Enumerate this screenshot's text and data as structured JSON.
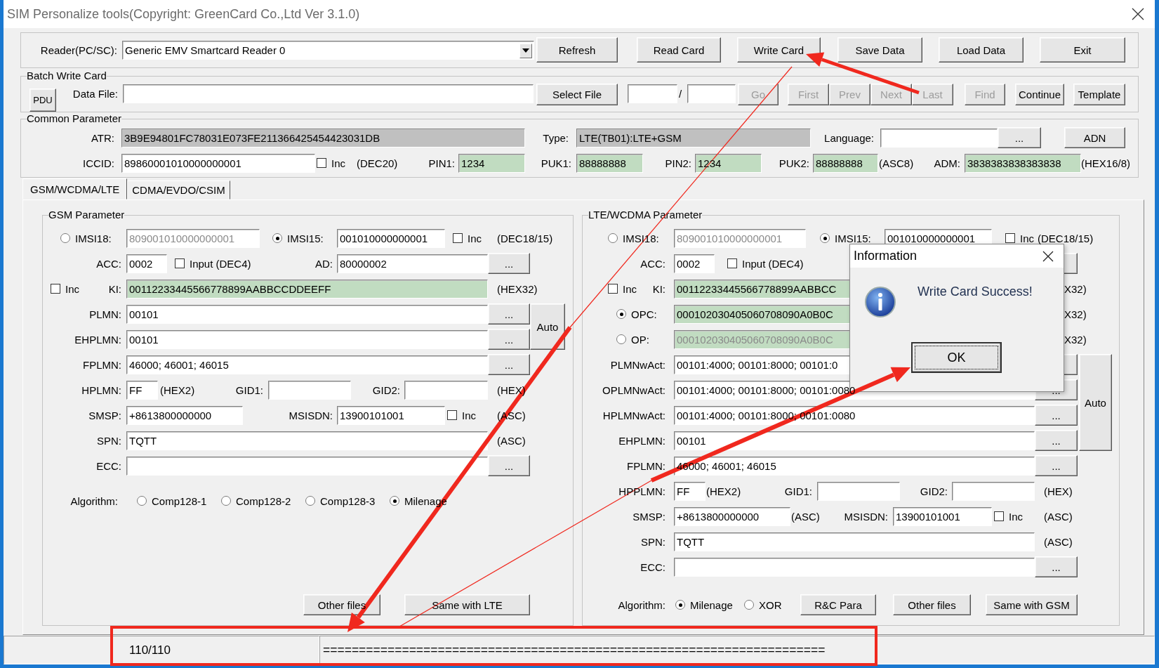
{
  "window": {
    "title": "SIM Personalize tools(Copyright: GreenCard Co.,Ltd Ver 3.1.0)"
  },
  "reader_bar": {
    "items": [
      {
        "kind": "label",
        "text": "Reader(PC/SC):"
      },
      {
        "kind": "combo",
        "value": "Generic EMV Smartcard Reader 0"
      },
      {
        "kind": "button",
        "text": "Refresh",
        "disabled": false
      },
      {
        "kind": "button",
        "text": "Read Card",
        "disabled": false
      },
      {
        "kind": "button",
        "text": "Write Card",
        "disabled": false
      },
      {
        "kind": "button",
        "text": "Save Data",
        "disabled": false
      },
      {
        "kind": "button",
        "text": "Load Data",
        "disabled": false
      },
      {
        "kind": "button",
        "text": "Exit",
        "disabled": false
      }
    ]
  },
  "batch": {
    "title": "Batch Write Card",
    "items": [
      {
        "kind": "button",
        "text": "PDU",
        "disabled": false
      },
      {
        "kind": "label",
        "text": "Data File:"
      },
      {
        "kind": "field"
      },
      {
        "kind": "button",
        "text": "Select File",
        "disabled": false
      },
      {
        "kind": "field"
      },
      {
        "kind": "note",
        "text": "/"
      },
      {
        "kind": "field"
      },
      {
        "kind": "button",
        "text": "Go",
        "disabled": true
      },
      {
        "kind": "button",
        "text": "First",
        "disabled": true
      },
      {
        "kind": "button",
        "text": "Prev",
        "disabled": true
      },
      {
        "kind": "button",
        "text": "Next",
        "disabled": true
      },
      {
        "kind": "button",
        "text": "Last",
        "disabled": true
      },
      {
        "kind": "button",
        "text": "Find",
        "disabled": true
      },
      {
        "kind": "button",
        "text": "Continue",
        "disabled": false
      },
      {
        "kind": "button",
        "text": "Template",
        "disabled": false
      }
    ]
  },
  "common": {
    "title": "Common Parameter",
    "rows": [
      {
        "kind": "row",
        "items": [
          {
            "kind": "label",
            "text": "ATR:"
          },
          {
            "kind": "grey-field",
            "value": "3B9E94801FC78031E073FE211366425454423031DB",
            "disabled": false
          },
          {
            "kind": "label",
            "text": "Type:"
          },
          {
            "kind": "grey-field",
            "value": "LTE(TB01):LTE+GSM",
            "disabled": false
          },
          {
            "kind": "label",
            "text": "Language:"
          },
          {
            "kind": "field"
          },
          {
            "kind": "button",
            "text": "...",
            "disabled": false
          },
          {
            "kind": "button",
            "text": "ADN",
            "disabled": false
          }
        ]
      },
      {
        "kind": "row",
        "items": [
          {
            "kind": "label",
            "text": "ICCID:"
          },
          {
            "kind": "field",
            "value": "89860001010000000001",
            "disabled": false
          },
          {
            "kind": "check",
            "text": "Inc",
            "checked": false
          },
          {
            "kind": "note",
            "text": "(DEC20)"
          },
          {
            "kind": "label",
            "text": "PIN1:"
          },
          {
            "kind": "green-field",
            "value": "1234",
            "disabled": false
          },
          {
            "kind": "label",
            "text": "PUK1:"
          },
          {
            "kind": "green-field",
            "value": "88888888",
            "disabled": false
          },
          {
            "kind": "label",
            "text": "PIN2:"
          },
          {
            "kind": "green-field",
            "value": "1234",
            "disabled": false
          },
          {
            "kind": "label",
            "text": "PUK2:"
          },
          {
            "kind": "green-field",
            "value": "88888888",
            "disabled": false
          },
          {
            "kind": "note",
            "text": "(ASC8)"
          },
          {
            "kind": "label",
            "text": "ADM:"
          },
          {
            "kind": "green-field",
            "value": "3838383838383838",
            "disabled": false
          },
          {
            "kind": "note",
            "text": "(HEX16/8)"
          }
        ]
      }
    ]
  },
  "tabs": [
    {
      "label": "GSM/WCDMA/LTE",
      "selected": true
    },
    {
      "label": "CDMA/EVDO/CSIM",
      "selected": false
    }
  ],
  "gsm": {
    "title": "GSM Parameter",
    "rows": [
      {
        "kind": "row",
        "items": [
          {
            "kind": "radio",
            "text": "IMSI18:",
            "selected": false
          },
          {
            "kind": "field",
            "value": "809001010000000001",
            "disabled": true
          },
          {
            "kind": "radio",
            "text": "IMSI15:",
            "selected": true
          },
          {
            "kind": "field",
            "value": "001010000000001",
            "disabled": false
          },
          {
            "kind": "check",
            "text": "Inc",
            "checked": false
          },
          {
            "kind": "note",
            "text": "(DEC18/15)"
          }
        ]
      },
      {
        "kind": "row",
        "items": [
          {
            "kind": "label",
            "text": "ACC:"
          },
          {
            "kind": "field",
            "value": "0002",
            "disabled": false
          },
          {
            "kind": "check",
            "text": "Input (DEC4)",
            "checked": false
          },
          {
            "kind": "label",
            "text": "AD:"
          },
          {
            "kind": "field",
            "value": "80000002",
            "disabled": false
          },
          {
            "kind": "button",
            "text": "...",
            "disabled": false
          }
        ]
      },
      {
        "kind": "row",
        "items": [
          {
            "kind": "check",
            "text": "Inc",
            "checked": false
          },
          {
            "kind": "label",
            "text": "KI:"
          },
          {
            "kind": "green-field",
            "value": "00112233445566778899AABBCCDDEEFF",
            "disabled": false
          },
          {
            "kind": "note",
            "text": "(HEX32)"
          }
        ]
      },
      {
        "kind": "group",
        "side": {
          "text": "Auto",
          "disabled": false
        },
        "rows": [
          {
            "kind": "row",
            "items": [
              {
                "kind": "label",
                "text": "PLMN:"
              },
              {
                "kind": "field",
                "value": "00101",
                "disabled": false
              },
              {
                "kind": "button",
                "text": "...",
                "disabled": false
              }
            ]
          },
          {
            "kind": "row",
            "items": [
              {
                "kind": "label",
                "text": "EHPLMN:"
              },
              {
                "kind": "field",
                "value": "00101",
                "disabled": false
              },
              {
                "kind": "button",
                "text": "...",
                "disabled": false
              }
            ]
          }
        ]
      },
      {
        "kind": "row",
        "items": [
          {
            "kind": "label",
            "text": "FPLMN:"
          },
          {
            "kind": "field",
            "value": "46000; 46001; 46015",
            "disabled": false
          },
          {
            "kind": "button",
            "text": "...",
            "disabled": false
          }
        ]
      },
      {
        "kind": "row",
        "items": [
          {
            "kind": "label",
            "text": "HPLMN:"
          },
          {
            "kind": "field",
            "value": "FF",
            "disabled": false
          },
          {
            "kind": "note",
            "text": "(HEX2)"
          },
          {
            "kind": "label",
            "text": "GID1:"
          },
          {
            "kind": "field"
          },
          {
            "kind": "label",
            "text": "GID2:"
          },
          {
            "kind": "field"
          },
          {
            "kind": "note",
            "text": "(HEX)"
          }
        ]
      },
      {
        "kind": "row",
        "items": [
          {
            "kind": "label",
            "text": "SMSP:"
          },
          {
            "kind": "field",
            "value": "+8613800000000",
            "disabled": false
          },
          {
            "kind": "label",
            "text": "MSISDN:"
          },
          {
            "kind": "field",
            "value": "13900101001",
            "disabled": false
          },
          {
            "kind": "check",
            "text": "Inc",
            "checked": false
          },
          {
            "kind": "note",
            "text": "(ASC)"
          }
        ]
      },
      {
        "kind": "row",
        "items": [
          {
            "kind": "label",
            "text": "SPN:"
          },
          {
            "kind": "field",
            "value": "TQTT",
            "disabled": false
          },
          {
            "kind": "note",
            "text": "(ASC)"
          }
        ]
      },
      {
        "kind": "row",
        "items": [
          {
            "kind": "label",
            "text": "ECC:"
          },
          {
            "kind": "field"
          },
          {
            "kind": "button",
            "text": "...",
            "disabled": false
          }
        ]
      },
      {
        "kind": "algo",
        "items": [
          {
            "kind": "label",
            "text": "Algorithm:"
          },
          {
            "kind": "radio",
            "text": "Comp128-1",
            "selected": false
          },
          {
            "kind": "radio",
            "text": "Comp128-2",
            "selected": false
          },
          {
            "kind": "radio",
            "text": "Comp128-3",
            "selected": false
          },
          {
            "kind": "radio",
            "text": "Milenage",
            "selected": true
          }
        ]
      },
      {
        "kind": "bottom",
        "items": [
          {
            "kind": "button",
            "text": "Other files",
            "disabled": false
          },
          {
            "kind": "button",
            "text": "Same with LTE",
            "disabled": false
          }
        ]
      }
    ]
  },
  "lte": {
    "title": "LTE/WCDMA Parameter",
    "rows": [
      {
        "kind": "row",
        "items": [
          {
            "kind": "radio",
            "text": "IMSI18:",
            "selected": false
          },
          {
            "kind": "field",
            "value": "809001010000000001",
            "disabled": true
          },
          {
            "kind": "radio",
            "text": "IMSI15:",
            "selected": true
          },
          {
            "kind": "field",
            "value": "001010000000001",
            "disabled": false
          },
          {
            "kind": "check",
            "text": "Inc",
            "checked": false
          },
          {
            "kind": "note",
            "text": "(DEC18/15)"
          }
        ]
      },
      {
        "kind": "row",
        "items": [
          {
            "kind": "label",
            "text": "ACC:"
          },
          {
            "kind": "field",
            "value": "0002",
            "disabled": false
          },
          {
            "kind": "check",
            "text": "Input (DEC4)",
            "checked": false
          },
          {
            "kind": "button"
          }
        ]
      },
      {
        "kind": "row",
        "items": [
          {
            "kind": "check",
            "text": "Inc",
            "checked": false
          },
          {
            "kind": "label",
            "text": "KI:"
          },
          {
            "kind": "green-field",
            "value": "00112233445566778899AABBCC",
            "disabled": false
          },
          {
            "kind": "note",
            "text": "X32)"
          }
        ]
      },
      {
        "kind": "row",
        "items": [
          {
            "kind": "radio",
            "text": "OPC:",
            "selected": true
          },
          {
            "kind": "green-field",
            "value": "000102030405060708090A0B0C",
            "disabled": false
          },
          {
            "kind": "note",
            "text": "X32)"
          }
        ]
      },
      {
        "kind": "row",
        "items": [
          {
            "kind": "radio",
            "text": "OP:",
            "selected": false
          },
          {
            "kind": "green-field",
            "value": "000102030405060708090A0B0C",
            "disabled": true
          },
          {
            "kind": "note",
            "text": "X32)"
          }
        ]
      },
      {
        "kind": "group",
        "side": {
          "text": "Auto",
          "disabled": false
        },
        "rows": [
          {
            "kind": "row",
            "items": [
              {
                "kind": "label",
                "text": "PLMNwAct:"
              },
              {
                "kind": "field",
                "value": "00101:4000; 00101:8000; 00101:0",
                "disabled": false
              },
              {
                "kind": "button"
              }
            ]
          },
          {
            "kind": "row",
            "items": [
              {
                "kind": "label",
                "text": "OPLMNwAct:"
              },
              {
                "kind": "field",
                "value": "00101:4000; 00101:8000; 00101:0080",
                "disabled": false
              },
              {
                "kind": "button",
                "text": "...",
                "disabled": false
              }
            ]
          },
          {
            "kind": "row",
            "items": [
              {
                "kind": "label",
                "text": "HPLMNwAct:"
              },
              {
                "kind": "field",
                "value": "00101:4000; 00101:8000; 00101:0080",
                "disabled": false
              },
              {
                "kind": "button",
                "text": "...",
                "disabled": false
              }
            ]
          },
          {
            "kind": "row",
            "items": [
              {
                "kind": "label",
                "text": "EHPLMN:"
              },
              {
                "kind": "field",
                "value": "00101",
                "disabled": false
              },
              {
                "kind": "button",
                "text": "...",
                "disabled": false
              }
            ]
          }
        ]
      },
      {
        "kind": "row",
        "items": [
          {
            "kind": "label",
            "text": "FPLMN:"
          },
          {
            "kind": "field",
            "value": "46000; 46001; 46015",
            "disabled": false
          },
          {
            "kind": "button",
            "text": "...",
            "disabled": false
          }
        ]
      },
      {
        "kind": "row",
        "items": [
          {
            "kind": "label",
            "text": "HPPLMN:"
          },
          {
            "kind": "field",
            "value": "FF",
            "disabled": false
          },
          {
            "kind": "note",
            "text": "(HEX2)"
          },
          {
            "kind": "label",
            "text": "GID1:"
          },
          {
            "kind": "field"
          },
          {
            "kind": "label",
            "text": "GID2:"
          },
          {
            "kind": "field"
          },
          {
            "kind": "note",
            "text": "(HEX)"
          }
        ]
      },
      {
        "kind": "row",
        "items": [
          {
            "kind": "label",
            "text": "SMSP:"
          },
          {
            "kind": "field",
            "value": "+8613800000000",
            "disabled": false
          },
          {
            "kind": "note",
            "text": "(ASC)"
          },
          {
            "kind": "label",
            "text": "MSISDN:"
          },
          {
            "kind": "field",
            "value": "13900101001",
            "disabled": false
          },
          {
            "kind": "check",
            "text": "Inc",
            "checked": false
          },
          {
            "kind": "note",
            "text": "(ASC)"
          }
        ]
      },
      {
        "kind": "row",
        "items": [
          {
            "kind": "label",
            "text": "SPN:"
          },
          {
            "kind": "field",
            "value": "TQTT",
            "disabled": false
          },
          {
            "kind": "note",
            "text": "(ASC)"
          }
        ]
      },
      {
        "kind": "row",
        "items": [
          {
            "kind": "label",
            "text": "ECC:"
          },
          {
            "kind": "field"
          },
          {
            "kind": "button",
            "text": "...",
            "disabled": false
          }
        ]
      },
      {
        "kind": "bottom",
        "items": [
          {
            "kind": "label",
            "text": "Algorithm:"
          },
          {
            "kind": "radio",
            "text": "Milenage",
            "selected": true
          },
          {
            "kind": "radio",
            "text": "XOR",
            "selected": false
          },
          {
            "kind": "button",
            "text": "R&C Para",
            "disabled": false
          },
          {
            "kind": "button",
            "text": "Other files",
            "disabled": false
          },
          {
            "kind": "button",
            "text": "Same with GSM",
            "disabled": false
          }
        ]
      }
    ]
  },
  "dialog": {
    "title": "Information",
    "message": "Write Card Success!",
    "button": "OK"
  },
  "status_bar": {
    "count": "110/110",
    "progress": "======================================================================"
  }
}
